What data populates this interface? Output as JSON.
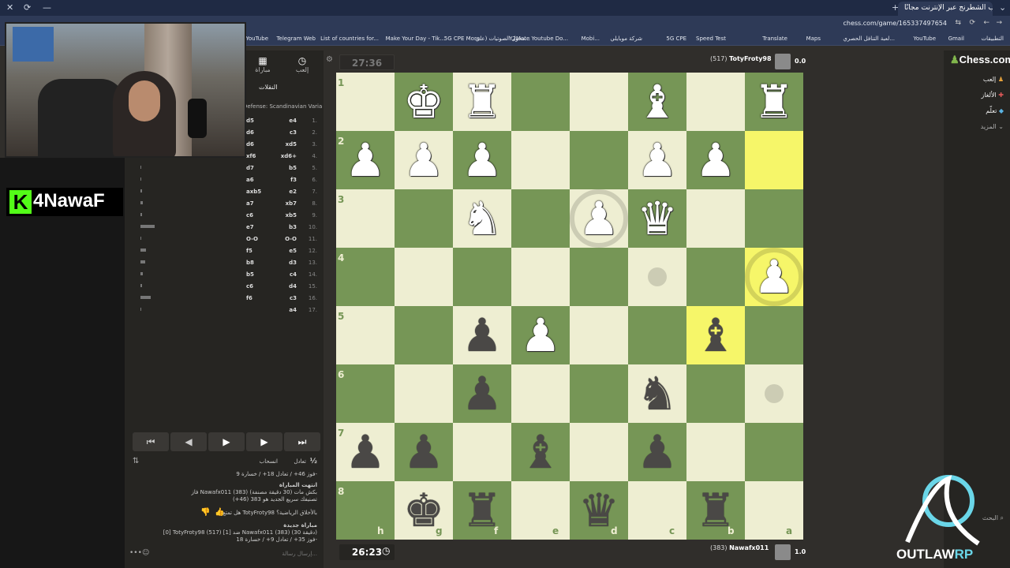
{
  "browser": {
    "tab_title": "إلعب الشطرنج عبر الإنترنت مجانًا",
    "url": "chess.com/game/165337497654",
    "bookmarks": [
      "التطبيقات",
      "Gmail",
      "YouTube",
      "لعبة التنافل الحصري...",
      "Maps",
      "Translate",
      "Speed Test",
      "5G CPE",
      "شركة موبايلي",
      "Mobi...",
      "Y2Mate Youtube Do...",
      "محول الصوتيات (علي...",
      "5G CPE More",
      "Make Your Day - Tik...",
      "List of countries for...",
      "Telegram Web",
      "YouTube"
    ]
  },
  "streamer": {
    "logo_letter": "K",
    "logo_text": "4NawaF"
  },
  "panel": {
    "tab_play": "إلعب",
    "tab_match": "مباراة",
    "tab_moves": "النقلات",
    "opening": "Defense: Scandinavian Variation",
    "moves": [
      {
        "n": "1.",
        "w": "e4",
        "b": "d5",
        "tw": 2.2,
        "tb": 0.8
      },
      {
        "n": "2.",
        "w": "c3",
        "b": "d6",
        "tw": 3.0,
        "tb": 1.6
      },
      {
        "n": "3.",
        "w": "xd5",
        "b": "d6",
        "tw": 1.0,
        "tb": 2.0
      },
      {
        "n": "4.",
        "w": "xd6+",
        "b": "xf6",
        "tw": 2.4,
        "tb": 2.0
      },
      {
        "n": "5.",
        "w": "b5",
        "b": "d7",
        "tw": 5.8,
        "tb": 2.7
      },
      {
        "n": "6.",
        "w": "f3",
        "b": "a6",
        "tw": 5.6,
        "tb": 3.2
      },
      {
        "n": "7.",
        "w": "e2",
        "b": "axb5",
        "tw": 13.5,
        "tb": 5.9
      },
      {
        "n": "8.",
        "w": "xb7",
        "b": "a7",
        "tw": 2.7,
        "tb": 7.6
      },
      {
        "n": "9.",
        "w": "xb5",
        "b": "c6",
        "tw": 4.6,
        "tb": 3.9
      },
      {
        "n": "10.",
        "w": "b3",
        "b": "e7",
        "tw": 2.0,
        "tb": 43.9
      },
      {
        "n": "11.",
        "w": "O-O",
        "b": "O-O",
        "tw": 6.4,
        "tb": 3.6
      },
      {
        "n": "12.",
        "w": "e5",
        "b": "f5",
        "tw": 1.7,
        "tb": 16.4
      },
      {
        "n": "13.",
        "w": "d3",
        "b": "b8",
        "tw": 16.1,
        "tb": 14.8
      },
      {
        "n": "14.",
        "w": "c4",
        "b": "b5",
        "tw": 8.6,
        "tb": 7.8
      },
      {
        "n": "15.",
        "w": "d4",
        "b": "c6",
        "tw": 15.8,
        "tb": 6.1
      },
      {
        "n": "16.",
        "w": "c3",
        "b": "f6",
        "tw": 35.4,
        "tb": 33.5
      },
      {
        "n": "17.",
        "w": "a4",
        "b": "",
        "tw": 10.7,
        "tb": 0
      }
    ],
    "nav": [
      "⏮",
      "◀",
      "▶",
      "▶",
      "⏭"
    ],
    "draw_label": "تعادل",
    "resign_label": "انسحاب",
    "half": "½",
    "record_line": "فوز 46+ / تعادل 18+ / خسارة 9-",
    "game_over_title": "انتهت المباراة",
    "game_over_line1": "فاز Nawafx011 (383) بكش مات (30 دقيقة مصنفة)",
    "game_over_line2": "تصنيفك سريع الجديد هو 383 (46+)",
    "enjoy_question": "هل تمتع TotyFroty98 بالأخلاق الرياضية؟",
    "new_game": "مباراة جديدة",
    "new_game_line": "[0] TotyFroty98 (517) ضد [1] Nawafx011 (383) (30 دقيقة)",
    "new_record": "فوز 35+ / تعادل 9+ / خسارة 18-",
    "chat_placeholder": "إرسال رسالة..."
  },
  "board": {
    "ranks": [
      "1",
      "2",
      "3",
      "4",
      "5",
      "6",
      "7",
      "8"
    ],
    "files": [
      "h",
      "g",
      "f",
      "e",
      "d",
      "c",
      "b",
      "a"
    ],
    "pieces": [
      {
        "r": 0,
        "c": 1,
        "color": "white",
        "glyph": "♚",
        "name": "white-king"
      },
      {
        "r": 0,
        "c": 2,
        "color": "white",
        "glyph": "♜",
        "name": "white-rook"
      },
      {
        "r": 0,
        "c": 5,
        "color": "white",
        "glyph": "♝",
        "name": "white-bishop"
      },
      {
        "r": 0,
        "c": 7,
        "color": "white",
        "glyph": "♜",
        "name": "white-rook"
      },
      {
        "r": 1,
        "c": 0,
        "color": "white",
        "glyph": "♟",
        "name": "white-pawn"
      },
      {
        "r": 1,
        "c": 1,
        "color": "white",
        "glyph": "♟",
        "name": "white-pawn"
      },
      {
        "r": 1,
        "c": 2,
        "color": "white",
        "glyph": "♟",
        "name": "white-pawn"
      },
      {
        "r": 1,
        "c": 5,
        "color": "white",
        "glyph": "♟",
        "name": "white-pawn"
      },
      {
        "r": 1,
        "c": 6,
        "color": "white",
        "glyph": "♟",
        "name": "white-pawn"
      },
      {
        "r": 2,
        "c": 2,
        "color": "white",
        "glyph": "♞",
        "name": "white-knight"
      },
      {
        "r": 2,
        "c": 4,
        "color": "white",
        "glyph": "♟",
        "name": "white-pawn"
      },
      {
        "r": 2,
        "c": 5,
        "color": "white",
        "glyph": "♛",
        "name": "white-queen"
      },
      {
        "r": 3,
        "c": 7,
        "color": "white",
        "glyph": "♟",
        "name": "white-pawn"
      },
      {
        "r": 4,
        "c": 2,
        "color": "black",
        "glyph": "♟",
        "name": "black-pawn"
      },
      {
        "r": 4,
        "c": 3,
        "color": "white",
        "glyph": "♟",
        "name": "white-pawn"
      },
      {
        "r": 4,
        "c": 6,
        "color": "black",
        "glyph": "♝",
        "name": "black-bishop"
      },
      {
        "r": 5,
        "c": 2,
        "color": "black",
        "glyph": "♟",
        "name": "black-pawn"
      },
      {
        "r": 5,
        "c": 5,
        "color": "black",
        "glyph": "♞",
        "name": "black-knight"
      },
      {
        "r": 6,
        "c": 0,
        "color": "black",
        "glyph": "♟",
        "name": "black-pawn"
      },
      {
        "r": 6,
        "c": 1,
        "color": "black",
        "glyph": "♟",
        "name": "black-pawn"
      },
      {
        "r": 6,
        "c": 3,
        "color": "black",
        "glyph": "♝",
        "name": "black-bishop"
      },
      {
        "r": 6,
        "c": 5,
        "color": "black",
        "glyph": "♟",
        "name": "black-pawn"
      },
      {
        "r": 7,
        "c": 1,
        "color": "black",
        "glyph": "♚",
        "name": "black-king"
      },
      {
        "r": 7,
        "c": 2,
        "color": "black",
        "glyph": "♜",
        "name": "black-rook"
      },
      {
        "r": 7,
        "c": 4,
        "color": "black",
        "glyph": "♛",
        "name": "black-queen"
      },
      {
        "r": 7,
        "c": 6,
        "color": "black",
        "glyph": "♜",
        "name": "black-rook"
      }
    ],
    "highlights": [
      {
        "r": 1,
        "c": 7
      },
      {
        "r": 3,
        "c": 7
      },
      {
        "r": 4,
        "c": 6
      }
    ],
    "move_dots": [
      {
        "r": 3,
        "c": 5
      },
      {
        "r": 5,
        "c": 7
      }
    ],
    "capture_rings": [
      {
        "r": 2,
        "c": 4
      },
      {
        "r": 3,
        "c": 7
      }
    ],
    "colors": {
      "light": "#eeeed2",
      "dark": "#769656",
      "highlight": "#f6f669"
    }
  },
  "top_player": {
    "name": "TotyFroty98",
    "rating": "(517)",
    "clock": "27:36",
    "score": "0.0"
  },
  "bottom_player": {
    "name": "Nawafx011",
    "rating": "(383)",
    "clock": "26:23",
    "score": "1.0"
  },
  "right_nav": {
    "brand": "Chess.com",
    "items": [
      "إلعب",
      "الألغاز",
      "تعلّم",
      "المزيد"
    ],
    "search": "البحث"
  },
  "overlay": {
    "brand": "OUTLAW",
    "suffix": "RP"
  }
}
